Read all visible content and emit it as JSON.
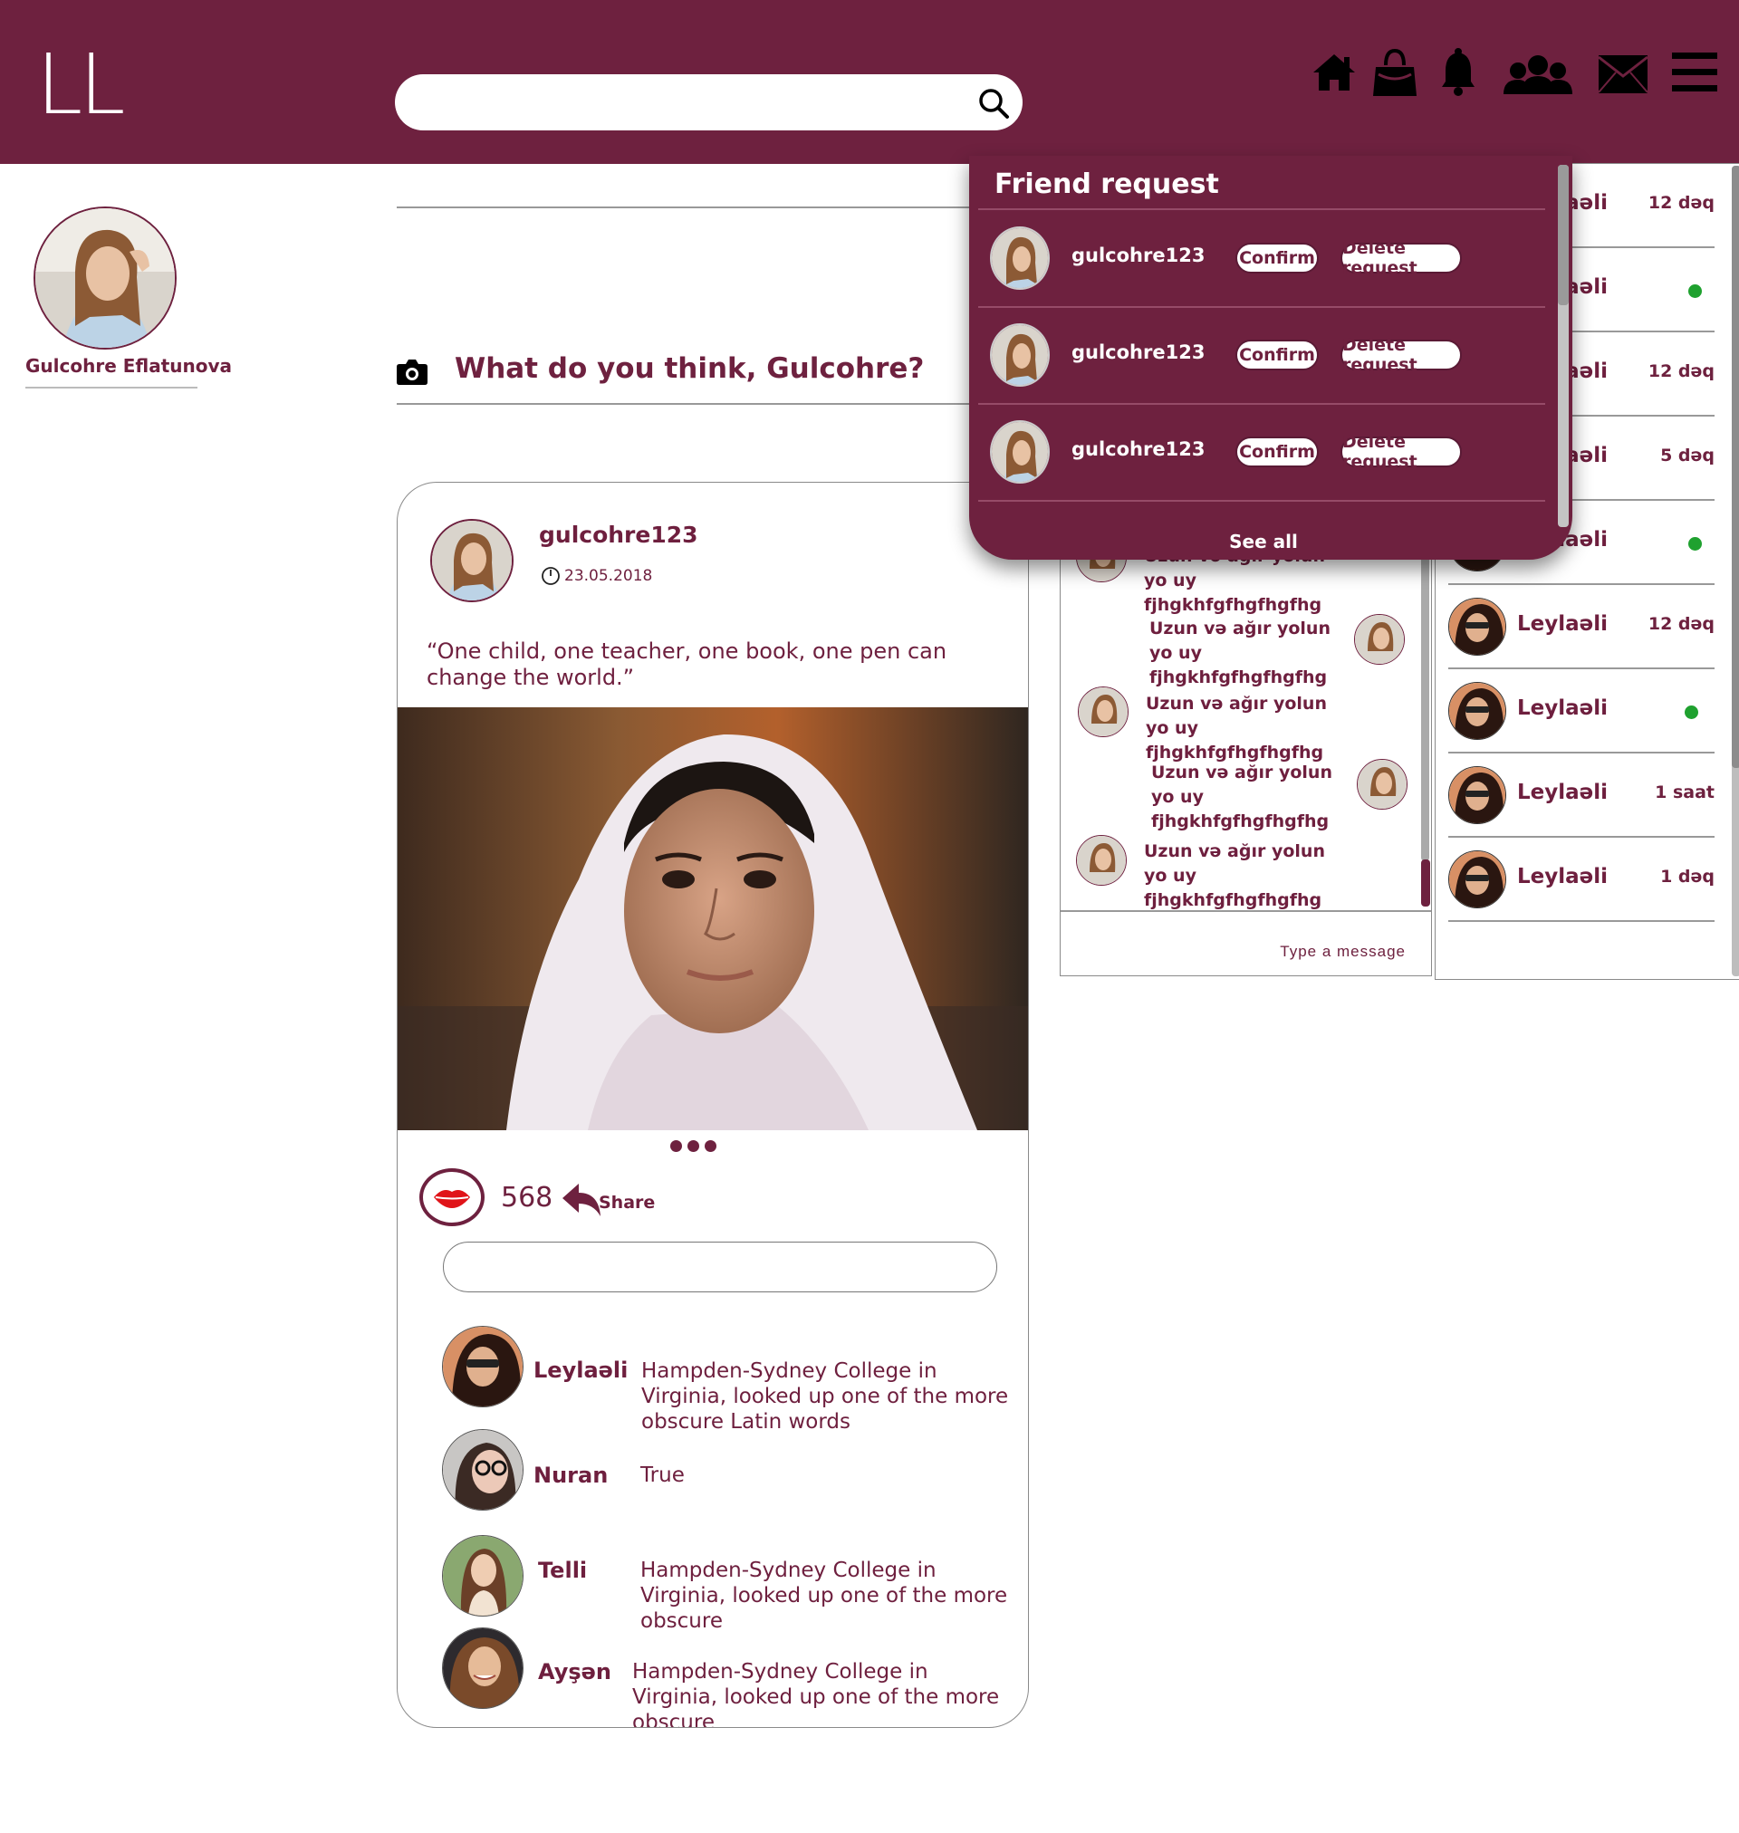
{
  "header": {
    "logo": "LL",
    "search": {
      "value": "",
      "placeholder": ""
    },
    "nav_icons": [
      "home-icon",
      "shopping-bag-icon",
      "bell-icon",
      "friends-icon",
      "mail-icon",
      "menu-icon"
    ]
  },
  "profile": {
    "name": "Gulcohre Eflatunova"
  },
  "composer": {
    "prompt": "What do you think, Gulcohre?"
  },
  "post": {
    "username": "gulcohre123",
    "date": "23.05.2018",
    "quote": "“One child, one teacher, one book, one pen can change the world.”",
    "likes": "568",
    "share_label": "Share",
    "comment_input": {
      "value": "",
      "placeholder": ""
    },
    "carousel_dots": 3,
    "comments": [
      {
        "name": "Leylaəli",
        "text": "Hampden-Sydney College in Virginia, looked up one of the more obscure Latin words"
      },
      {
        "name": "Nuran",
        "text": "True"
      },
      {
        "name": "Telli",
        "text": "Hampden-Sydney College in Virginia, looked up one of the more obscure"
      },
      {
        "name": "Ayşən",
        "text": "Hampden-Sydney College in Virginia, looked up one of the more obscure"
      }
    ]
  },
  "friend_requests": {
    "title": "Friend request",
    "items": [
      {
        "username": "gulcohre123",
        "confirm_label": "Confirm",
        "delete_label": "Delete request"
      },
      {
        "username": "gulcohre123",
        "confirm_label": "Confirm",
        "delete_label": "Delete request"
      },
      {
        "username": "gulcohre123",
        "confirm_label": "Confirm",
        "delete_label": "Delete request"
      }
    ],
    "see_all": "See all"
  },
  "chat": {
    "messages": [
      {
        "text": "Uzun və ağır yolun yo uy fjhgkhfgfhgfhgfhg",
        "side": "left"
      },
      {
        "text": "Uzun və ağır yolun yo uy fjhgkhfgfhgfhgfhg",
        "side": "right"
      },
      {
        "text": "Uzun və ağır yolun yo uy fjhgkhfgfhgfhgfhg",
        "side": "left"
      },
      {
        "text": "Uzun və ağır yolun yo uy fjhgkhfgfhgfhgfhg",
        "side": "right"
      },
      {
        "text": "Uzun və ağır yolun yo uy fjhgkhfgfhgfhgfhg",
        "side": "left"
      }
    ],
    "input_placeholder": "Type a message"
  },
  "contacts": [
    {
      "name": "Leylaəli",
      "status": "12 dəq",
      "online": false
    },
    {
      "name": "Leylaəli",
      "status": "",
      "online": true
    },
    {
      "name": "Leylaəli",
      "status": "12 dəq",
      "online": false
    },
    {
      "name": "Leylaəli",
      "status": "5 dəq",
      "online": false
    },
    {
      "name": "Leylaəli",
      "status": "",
      "online": true
    },
    {
      "name": "Leylaəli",
      "status": "12 dəq",
      "online": false
    },
    {
      "name": "Leylaəli",
      "status": "",
      "online": true
    },
    {
      "name": "Leylaəli",
      "status": "1 saat",
      "online": false
    },
    {
      "name": "Leylaəli",
      "status": "1 dəq",
      "online": false
    }
  ],
  "colors": {
    "brand": "#6e213f",
    "online": "#1fa12f",
    "white": "#ffffff"
  }
}
